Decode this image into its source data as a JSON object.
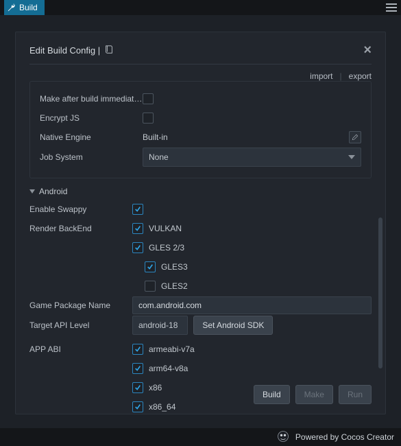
{
  "titlebar": {
    "title": "Build"
  },
  "panel": {
    "title": "Edit Build Config |"
  },
  "actions": {
    "import": "import",
    "export": "export"
  },
  "general": {
    "make_after_build": {
      "label": "Make after build immediat…",
      "checked": false
    },
    "encrypt_js": {
      "label": "Encrypt JS",
      "checked": false
    },
    "native_engine": {
      "label": "Native Engine",
      "value": "Built-in"
    },
    "job_system": {
      "label": "Job System",
      "value": "None"
    }
  },
  "section_android": {
    "title": "Android"
  },
  "android": {
    "enable_swappy": {
      "label": "Enable Swappy",
      "checked": true
    },
    "render_backend": {
      "label": "Render BackEnd",
      "vulkan": {
        "label": "VULKAN",
        "checked": true
      },
      "gles23": {
        "label": "GLES 2/3",
        "checked": true,
        "gles3": {
          "label": "GLES3",
          "checked": true
        },
        "gles2": {
          "label": "GLES2",
          "checked": false
        }
      }
    },
    "package_name": {
      "label": "Game Package Name",
      "value": "com.android.com"
    },
    "target_api": {
      "label": "Target API Level",
      "value": "android-18",
      "sdk_button": "Set Android SDK"
    },
    "app_abi": {
      "label": "APP ABI",
      "armeabi_v7a": {
        "label": "armeabi-v7a",
        "checked": true
      },
      "arm64_v8a": {
        "label": "arm64-v8a",
        "checked": true
      },
      "x86": {
        "label": "x86",
        "checked": true
      },
      "x86_64": {
        "label": "x86_64",
        "checked": true
      }
    }
  },
  "footer": {
    "build": "Build",
    "make": "Make",
    "run": "Run"
  },
  "bottombar": {
    "powered": "Powered by Cocos Creator"
  }
}
